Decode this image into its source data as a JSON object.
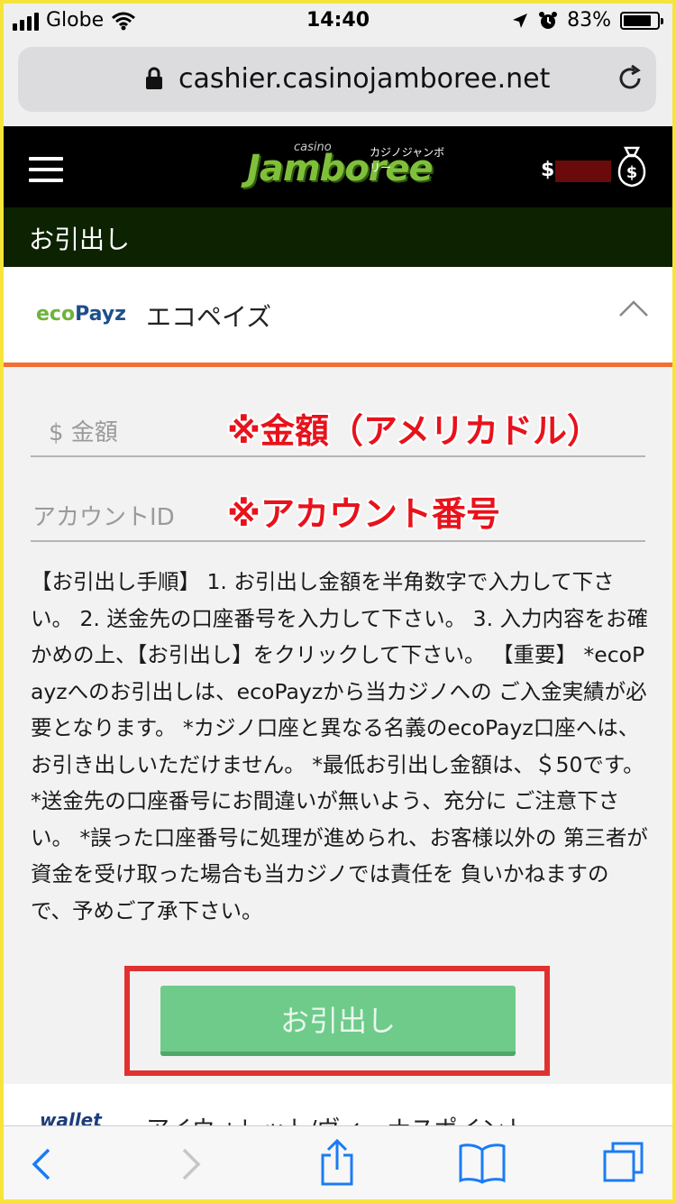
{
  "status_bar": {
    "carrier": "Globe",
    "time": "14:40",
    "battery_percent": "83%",
    "battery_level": 0.83
  },
  "browser": {
    "url": "cashier.casinojamboree.net"
  },
  "site_header": {
    "logo_small": "casino",
    "logo_main": "Jamboree",
    "logo_kana": "カジノジャンボリー",
    "currency_symbol": "$"
  },
  "page_title": "お引出し",
  "payment_method": {
    "logo_eco": "eco",
    "logo_payz": "Payz",
    "name": "エコペイズ"
  },
  "form": {
    "amount_placeholder": "$ 金額",
    "account_placeholder": "アカウントID",
    "amount_annotation": "※金額（アメリカドル）",
    "account_annotation": "※アカウント番号",
    "instructions": "【お引出し手順】 1. お引出し金額を半角数字で入力して下さい。 2. 送金先の口座番号を入力して下さい。 3. 入力内容をお確かめの上、【お引出し】をクリックして下さい。 【重要】 *ecoPayzへのお引出しは、ecoPayzから当カジノへの ご入金実績が必要となります。 *カジノ口座と異なる名義のecoPayz口座へは、 お引き出しいただけません。 *最低お引出し金額は、＄50です。 *送金先の口座番号にお間違いが無いよう、充分に ご注意下さい。 *誤った口座番号に処理が進められ、お客様以外の 第三者が資金を受け取った場合も当カジノでは責任を 負いかねますので、予めご了承下さい。",
    "submit_label": "お引出し"
  },
  "next_method": {
    "logo": "wallet",
    "name": "アイウォレット/ヴィーナスポイント"
  },
  "colors": {
    "accent_orange": "#f26f35",
    "button_green": "#6ecb8a",
    "annotation_red": "#e8121b",
    "title_bar": "#0c2200"
  },
  "icons": [
    "signal-icon",
    "wifi-icon",
    "location-icon",
    "alarm-icon",
    "battery-icon",
    "lock-icon",
    "reload-icon",
    "hamburger-icon",
    "money-bag-icon",
    "chevron-up-icon",
    "back-icon",
    "forward-icon",
    "share-icon",
    "bookmarks-icon",
    "tabs-icon"
  ]
}
